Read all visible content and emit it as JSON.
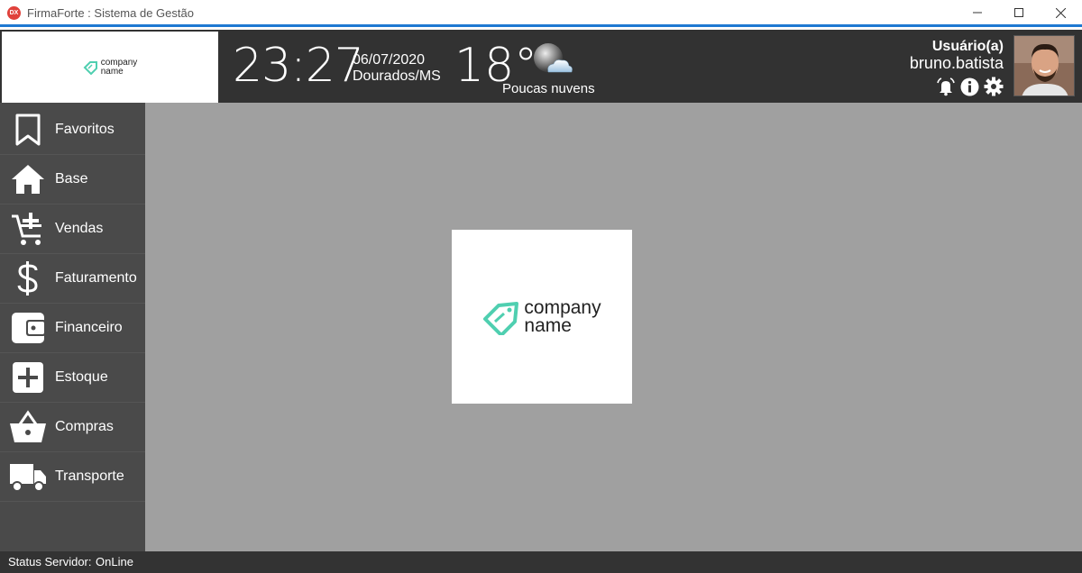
{
  "window": {
    "app_icon_text": "DX",
    "title": "FirmaForte : Sistema de Gestão",
    "minimize": "—",
    "maximize": "☐",
    "close": "✕"
  },
  "header": {
    "logo": {
      "line1": "company",
      "line2": "name"
    },
    "time": "23:27",
    "date": "06/07/2020",
    "city": "Dourados/MS",
    "temperature": "18°",
    "weather": "Poucas nuvens",
    "user_label": "Usuário(a)",
    "user_name": "bruno.batista",
    "icons": [
      "alarm-icon",
      "info-icon",
      "settings-icon"
    ]
  },
  "sidebar": {
    "items": [
      {
        "label": "Favoritos",
        "icon": "bookmark-icon"
      },
      {
        "label": "Base",
        "icon": "home-icon"
      },
      {
        "label": "Vendas",
        "icon": "cart-add-icon"
      },
      {
        "label": "Faturamento",
        "icon": "dollar-icon"
      },
      {
        "label": "Financeiro",
        "icon": "wallet-icon"
      },
      {
        "label": "Estoque",
        "icon": "plus-box-icon"
      },
      {
        "label": "Compras",
        "icon": "basket-icon"
      },
      {
        "label": "Transporte",
        "icon": "truck-icon"
      }
    ]
  },
  "main": {
    "logo": {
      "line1": "company",
      "line2": "name"
    }
  },
  "status": {
    "label": "Status Servidor:",
    "value": "OnLine"
  },
  "colors": {
    "accent": "#1e78d2",
    "header_bg": "#323232",
    "sidebar_bg": "#4a4a4a",
    "main_bg": "#a0a0a0",
    "logo_teal": "#4fcfb0"
  }
}
